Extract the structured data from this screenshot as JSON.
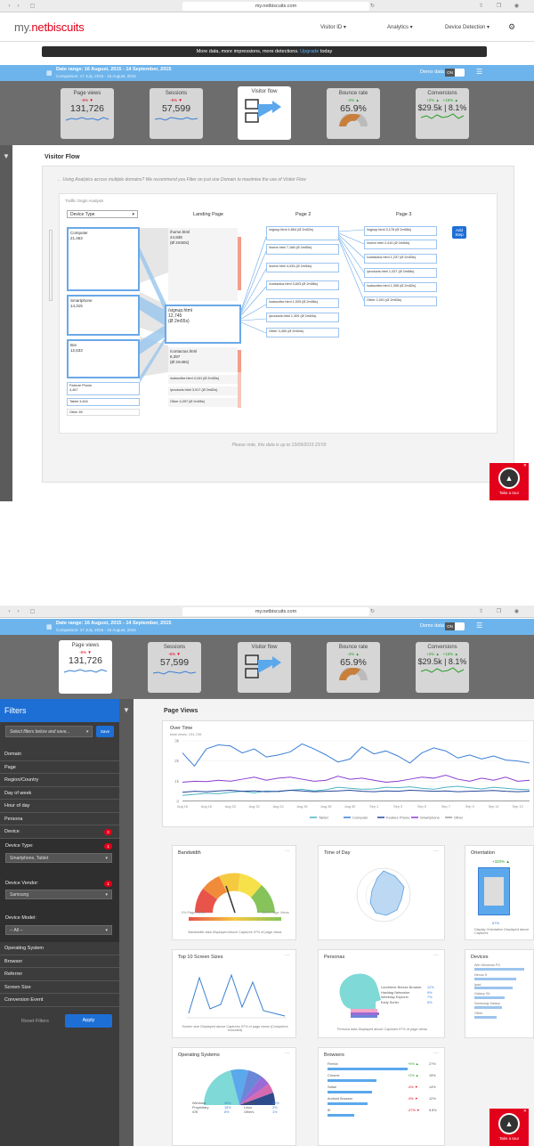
{
  "browser": {
    "url": "my.netbiscuits.com"
  },
  "app": {
    "logo_main": "my.",
    "logo_accent": "netbiscuits",
    "nav": [
      "Visitor ID",
      "Analytics",
      "Device Detection"
    ]
  },
  "promo": {
    "text": "More data, more impressions, more detections.",
    "link": "Upgrade",
    "suffix": "today"
  },
  "date": {
    "range": "Date range: 16 August, 2015 - 14 September, 2015",
    "comparison": "Comparison: 17 July, 2015 - 15 August, 2015",
    "demo_label": "Demo data",
    "toggle": "ON"
  },
  "kpis": [
    {
      "title": "Page views",
      "change": "-6%",
      "value": "131,726"
    },
    {
      "title": "Sessions",
      "change": "-6%",
      "value": "57,599"
    },
    {
      "title": "Visitor flow"
    },
    {
      "title": "Bounce rate",
      "change": "-4%",
      "value": "65.9%"
    },
    {
      "title": "Conversions",
      "change_a": "+2%",
      "change_b": "+15%",
      "value": "$29.5k | 8.1%"
    }
  ],
  "flow": {
    "title": "Visitor Flow",
    "notice": "Using Analytics across multiple domains? We recommend you Filter on just one Domain to maximise the use of Visitor Flow",
    "origin_label": "Traffic Origin Analysis",
    "origin_select": "Device Type",
    "col_landing": "Landing Page",
    "col_page2": "Page 2",
    "col_page3": "Page 3",
    "add_step": "Add Step",
    "origins": [
      {
        "name": "Computer",
        "value": "21,463"
      },
      {
        "name": "Smartphone",
        "value": "14,315"
      },
      {
        "name": "Bot",
        "value": "12,633"
      },
      {
        "name": "Feature Phone",
        "value": "4,467"
      },
      {
        "name": "Tablet",
        "value": "3,464"
      },
      {
        "name": "Other",
        "value": "69"
      }
    ],
    "landing": [
      {
        "path": "/home.html",
        "value": "24,938",
        "time": "(Ø 2m50s)"
      },
      {
        "path": "/signup.html",
        "value": "12,745",
        "time": "(Ø 2m55s)"
      },
      {
        "path": "/contactus.html",
        "value": "8,397",
        "time": "(Ø 2m48s)"
      },
      {
        "line": "/subscribe.html 4,161 (Ø 2m53s)"
      },
      {
        "line": "/products.html 3,917 (Ø 2m52s)"
      },
      {
        "line": "Other 4,097 (Ø 2m55s)"
      }
    ],
    "page2": [
      "/signup.html 4,894 (Ø 2m52s)",
      "/home.html 7,168 (Ø 2m50s)",
      "/home.html 4,034 (Ø 2m54s)",
      "/contactus.html 3,603 (Ø 2m56s)",
      "/subscribe.html 1,925 (Ø 2m56s)",
      "/products.html 1,309 (Ø 2m54s)",
      "Other 3,450 (Ø 2m54s)"
    ],
    "page3": [
      "/signup.html 3,178 (Ø 2m56s)",
      "/home.html 2,410 (Ø 2m54s)",
      "/contactus.html 1,237 (Ø 2m53s)",
      "/products.html 1,037 (Ø 2m58s)",
      "/subscribe.html 1,095 (Ø 2m52s)",
      "Other 2,091 (Ø 2m53s)"
    ],
    "footnote": "Please note, this data is up to 13/09/2015 23:59"
  },
  "tour": {
    "label": "Take a tour"
  },
  "filters": {
    "title": "Filters",
    "select_placeholder": "Select filters below and save...",
    "save": "Save",
    "items": [
      "Domain",
      "Page",
      "Region/Country",
      "Day of week",
      "Hour of day",
      "Persona",
      "Device"
    ],
    "device_badge": "3",
    "device_type_label": "Device Type:",
    "device_type_value": "Smartphone, Tablet",
    "device_type_badge": "1",
    "device_vendor_label": "Device Vendor:",
    "device_vendor_value": "Samsung",
    "device_vendor_badge": "1",
    "device_model_label": "Device Model:",
    "device_model_value": "-- All --",
    "items2": [
      "Operating System",
      "Browser",
      "Referrer",
      "Screen Size",
      "Conversion Event"
    ],
    "reset": "Reset Filters",
    "apply": "Apply"
  },
  "pageviews": {
    "title": "Page Views",
    "over_time": "Over Time",
    "total": "total views: 131,726",
    "yticks": [
      "3k",
      "2k",
      "1k",
      "0"
    ],
    "xticks": [
      "Aug 16",
      "Aug 18",
      "Aug 20",
      "Aug 22",
      "Aug 24",
      "Aug 26",
      "Aug 28",
      "Aug 30",
      "Sep 1",
      "Sep 3",
      "Sep 5",
      "Sep 7",
      "Sep 9",
      "Sep 11",
      "Sep 13"
    ],
    "legend": [
      "Tablet",
      "Computer",
      "Feature Phone",
      "Smartphone",
      "Other"
    ],
    "colors": [
      "#4db3c4",
      "#3a7fd5",
      "#26479a",
      "#8c3fd1",
      "#9e9e9e"
    ]
  },
  "chart_data": {
    "type": "line",
    "title": "Over Time",
    "x": [
      "Aug 16",
      "Aug 17",
      "Aug 18",
      "Aug 19",
      "Aug 20",
      "Aug 21",
      "Aug 22",
      "Aug 23",
      "Aug 24",
      "Aug 25",
      "Aug 26",
      "Aug 27",
      "Aug 28",
      "Aug 29",
      "Aug 30",
      "Aug 31",
      "Sep 1",
      "Sep 2",
      "Sep 3",
      "Sep 4",
      "Sep 5",
      "Sep 6",
      "Sep 7",
      "Sep 8",
      "Sep 9",
      "Sep 10",
      "Sep 11",
      "Sep 12",
      "Sep 13",
      "Sep 14"
    ],
    "ylim": [
      0,
      3000
    ],
    "series": [
      {
        "name": "Computer",
        "values": [
          2400,
          1750,
          2600,
          2800,
          2750,
          2400,
          2600,
          2200,
          2300,
          2450,
          2850,
          2600,
          2300,
          1950,
          2100,
          2700,
          2350,
          2500,
          2250,
          1900,
          2400,
          2650,
          2500,
          2150,
          2300,
          2100,
          2250,
          2050,
          2000,
          1900
        ]
      },
      {
        "name": "Smartphone",
        "values": [
          950,
          1000,
          980,
          1050,
          1000,
          1100,
          1200,
          1050,
          1150,
          1200,
          1100,
          1000,
          1050,
          1250,
          1100,
          1150,
          1050,
          950,
          1000,
          1100,
          1200,
          1150,
          1300,
          1100,
          1000,
          1150,
          1050,
          1200,
          1000,
          1050
        ]
      },
      {
        "name": "Tablet",
        "values": [
          300,
          350,
          400,
          380,
          450,
          500,
          420,
          520,
          480,
          550,
          600,
          520,
          580,
          700,
          650,
          600,
          620,
          700,
          680,
          720,
          650,
          600,
          700,
          750,
          680,
          620,
          700,
          650,
          600,
          580
        ]
      },
      {
        "name": "Feature Phone",
        "values": [
          450,
          500,
          480,
          520,
          550,
          500,
          520,
          480,
          500,
          550,
          520,
          480,
          500,
          520,
          550,
          500,
          480,
          520,
          500,
          550,
          530,
          500,
          520,
          480,
          500,
          520,
          540,
          500,
          480,
          500
        ]
      },
      {
        "name": "Other",
        "values": [
          20,
          25,
          30,
          20,
          25,
          30,
          20,
          25,
          20,
          30,
          25,
          20,
          25,
          30,
          20,
          25,
          30,
          20,
          25,
          20,
          30,
          25,
          20,
          25,
          30,
          20,
          25,
          20,
          30,
          25
        ]
      }
    ]
  },
  "cards": {
    "bandwidth": {
      "title": "Bandwidth",
      "low": "0% Page Views",
      "high": "100% Page Views",
      "caption": "Bandwidth data Displayed Above Captures 97% of page views"
    },
    "timeofday": {
      "title": "Time of Day"
    },
    "orientation": {
      "title": "Orientation",
      "change": "+320%",
      "pct": "67%",
      "caption": "Display Orientation Displayed above Captures"
    },
    "screens": {
      "title": "Top 10 Screen Sizes",
      "caption": "Screen size Displayed above Captures 97% of page views (Computers excluded)"
    },
    "personas": {
      "title": "Personas",
      "rows": [
        "Lunchtime Breeze Browser",
        "Hashtag Networker",
        "Weekday Explorer",
        "Early Surfer"
      ],
      "vals": [
        "12%",
        "9%",
        "7%",
        "5%"
      ],
      "caption": "Persona data Displayed above Captures 97% of page views"
    },
    "devices": {
      "title": "Devices",
      "rows": [
        "Win Windows PC",
        "Nexus 5",
        "Ipad",
        "Galaxy S4",
        "Samsung Galaxy",
        "Other"
      ]
    },
    "os": {
      "title": "Operating Systems",
      "rows": [
        "Windows",
        "Proprietary",
        "iOS",
        "Android",
        "Linux",
        "Others"
      ],
      "vals": [
        "45%",
        "18%",
        "8%",
        "25%",
        "3%",
        "1%"
      ]
    },
    "browsers": {
      "title": "Browsers",
      "rows": [
        {
          "name": "Firefox",
          "change": "+9%",
          "val": "27%"
        },
        {
          "name": "Chrome",
          "change": "+2%",
          "val": "15%"
        },
        {
          "name": "Safari",
          "change": "-4%",
          "val": "14%"
        },
        {
          "name": "Android Browser",
          "change": "-9%",
          "val": "12%"
        },
        {
          "name": "IE",
          "change": "-27%",
          "val": "5.8%"
        }
      ]
    }
  }
}
